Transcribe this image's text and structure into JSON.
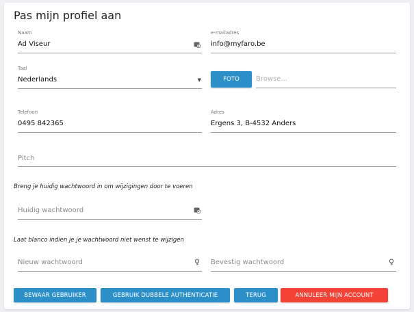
{
  "page": {
    "title": "Pas mijn profiel aan"
  },
  "form": {
    "naam": {
      "label": "Naam",
      "value": "Ad Viseur",
      "icon": "contact-card-icon"
    },
    "email": {
      "label": "e-mailadres",
      "value": "info@myfaro.be"
    },
    "taal": {
      "label": "Taal",
      "value": "Nederlands",
      "icon": "dropdown-arrow-icon"
    },
    "foto": {
      "button_label": "FOTO",
      "placeholder": "Browse..."
    },
    "telefoon": {
      "label": "Telefoon",
      "value": "0495 842365"
    },
    "adres": {
      "label": "Adres",
      "value": "Ergens 3, B-4532 Anders"
    },
    "pitch": {
      "placeholder": "Pitch"
    },
    "hint_current": "Breng je huidig wachtwoord in om wijzigingen door te voeren",
    "huidig_wachtwoord": {
      "placeholder": "Huidig wachtwoord",
      "icon": "contact-card-icon"
    },
    "hint_blank": "Laat blanco indien je je wachtwoord niet wenst te wijzigen",
    "nieuw_wachtwoord": {
      "placeholder": "Nieuw wachtwoord",
      "icon": "key-icon"
    },
    "bevestig_wachtwoord": {
      "placeholder": "Bevestig wachtwoord",
      "icon": "key-icon"
    }
  },
  "actions": {
    "save": "BEWAAR GEBRUIKER",
    "two_factor": "GEBRUIK DUBBELE AUTHENTICATIE",
    "back": "TERUG",
    "cancel_account": "ANNULEER MIJN ACCOUNT"
  },
  "colors": {
    "primary": "#2d8fc8",
    "danger": "#f44336",
    "background": "#eef0f3"
  }
}
